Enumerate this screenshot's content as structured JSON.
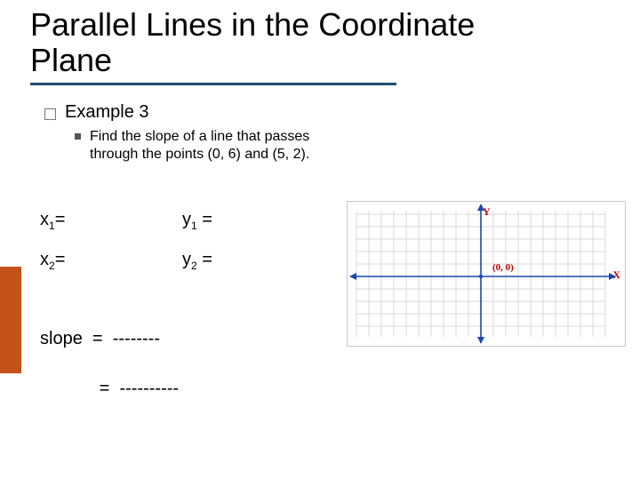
{
  "title_line1": "Parallel Lines in the Coordinate",
  "title_line2": "Plane",
  "example_label": "Example 3",
  "example_text": "Find the slope of a line that passes through the points (0, 6) and (5, 2).",
  "vars": {
    "x1_label": "x",
    "x1_sub": "1",
    "x1_eq": "=",
    "y1_label": "y",
    "y1_sub": "1",
    "y1_eq": "=",
    "x2_label": "x",
    "x2_sub": "2",
    "x2_eq": "=",
    "y2_label": "y",
    "y2_sub": "2",
    "y2_eq": "="
  },
  "slope": {
    "label1": "slope  =  --------",
    "label2": "            =  ----------"
  },
  "graph": {
    "y_axis": "Y",
    "x_axis": "X",
    "origin": "(0, 0)"
  },
  "chart_data": {
    "type": "scatter",
    "series": [],
    "title": "",
    "xlabel": "X",
    "ylabel": "Y",
    "xlim": [
      -10,
      10
    ],
    "ylim": [
      -6,
      6
    ],
    "origin_label": "(0, 0)",
    "grid": true
  }
}
